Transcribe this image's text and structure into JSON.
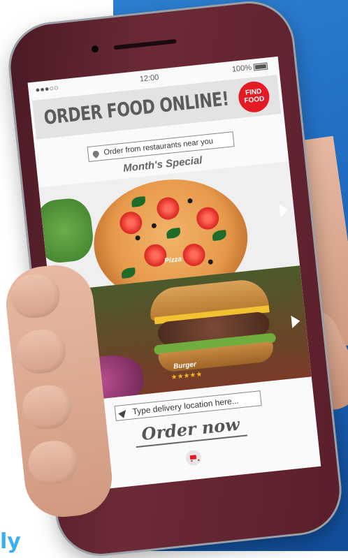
{
  "status_bar": {
    "signal": "●●●○○",
    "time": "12:00",
    "battery": "100%"
  },
  "header": {
    "title": "ORDER FOOD ONLINE!",
    "badge_line1": "FIND",
    "badge_line2": "FOOD"
  },
  "search": {
    "placeholder": "Order from restaurants near you"
  },
  "section": {
    "title": "Month's Special"
  },
  "slides": [
    {
      "label": "Pizza"
    },
    {
      "label": "Burger",
      "rating_stars": "★★★★★"
    }
  ],
  "delivery": {
    "placeholder": "Type delivery location here..."
  },
  "order": {
    "label": "Order now"
  },
  "corner_text": "ly",
  "colors": {
    "accent": "#e21b24",
    "phone_body": "#5a1f2b",
    "background_blue": "#1a62b8"
  }
}
